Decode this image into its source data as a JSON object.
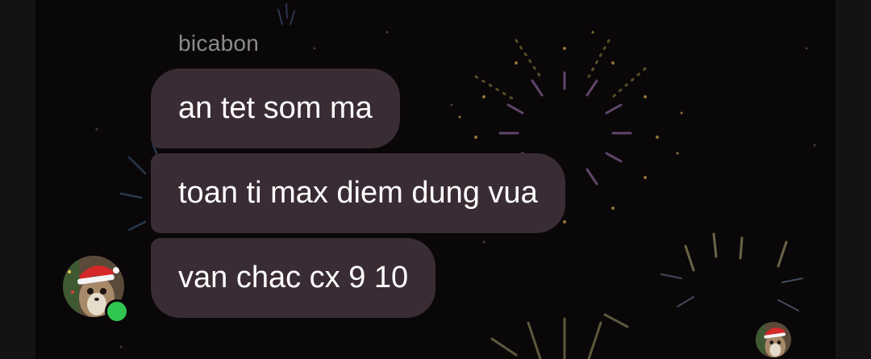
{
  "conversation": {
    "sender_name": "bicabon",
    "messages": [
      {
        "text": "an tet som ma"
      },
      {
        "text": "toan ti max diem dung vua"
      },
      {
        "text": "van chac cx 9 10"
      }
    ],
    "sender_status": "online"
  },
  "icons": {
    "sender_avatar": "squirrel-santa-hat-avatar-icon",
    "seen_receipt": "squirrel-santa-hat-avatar-icon",
    "online_indicator": "online-dot-icon"
  },
  "colors": {
    "background": "#0a0708",
    "bubble": "#3a2c34",
    "bubble_text": "#ffffff",
    "sender_name_text": "#8d8a8e",
    "online_dot": "#31c552"
  }
}
